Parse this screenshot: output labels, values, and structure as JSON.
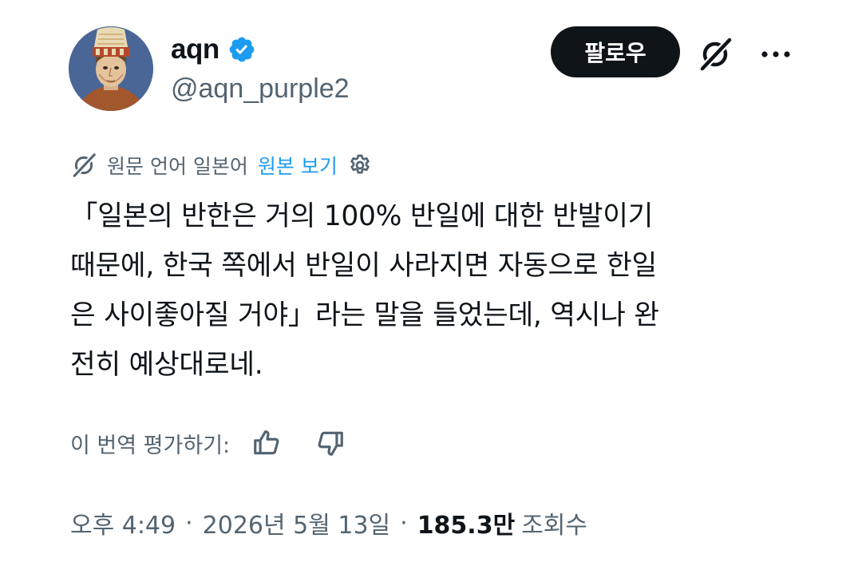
{
  "author": {
    "display_name": "aqn",
    "handle": "@aqn_purple2",
    "verified": true
  },
  "actions": {
    "follow_label": "팔로우",
    "grok_icon": "grok-icon",
    "more_icon": "more-icon"
  },
  "translation": {
    "note": "원문 언어 일본어",
    "show_original": "원본 보기",
    "settings_icon": "gear-icon"
  },
  "tweet": {
    "lines": [
      "「일본의 반한은 거의 100% 반일에 대한 반발이기",
      "때문에, 한국 쪽에서 반일이 사라지면 자동으로 한일",
      "은 사이좋아질 거야」라는 말을 들었는데, 역시나 완",
      "전히 예상대로네."
    ]
  },
  "rating": {
    "label": "이 번역 평가하기:"
  },
  "meta": {
    "time": "오후 4:49",
    "separator": "·",
    "date": "2026년 5월 13일",
    "views_count": "185.3만",
    "views_label": "조회수"
  },
  "colors": {
    "text": "#0f1419",
    "secondary": "#536471",
    "accent": "#1d9bf0",
    "button": "#0f1419"
  }
}
